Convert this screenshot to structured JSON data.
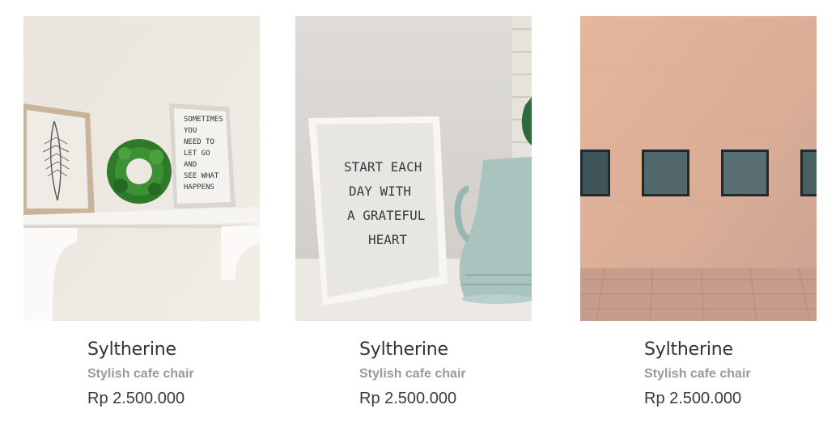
{
  "products": [
    {
      "name": "Syltherine",
      "subtitle": "Stylish cafe chair",
      "price": "Rp 2.500.000",
      "image": "shelf-with-frames-and-wreath",
      "poster_lines": [
        "SOMETIMES",
        "YOU",
        "NEED TO",
        "LET GO",
        "AND",
        "SEE WHAT",
        "HAPPENS"
      ]
    },
    {
      "name": "Syltherine",
      "subtitle": "Stylish cafe chair",
      "price": "Rp 2.500.000",
      "image": "frame-and-pitcher",
      "poster_lines": [
        "START EACH",
        "DAY WITH",
        "A GRATEFUL",
        "HEART"
      ]
    },
    {
      "name": "Syltherine",
      "subtitle": "Stylish cafe chair",
      "price": "Rp 2.500.000",
      "image": "gallery-wall-with-frames"
    }
  ]
}
